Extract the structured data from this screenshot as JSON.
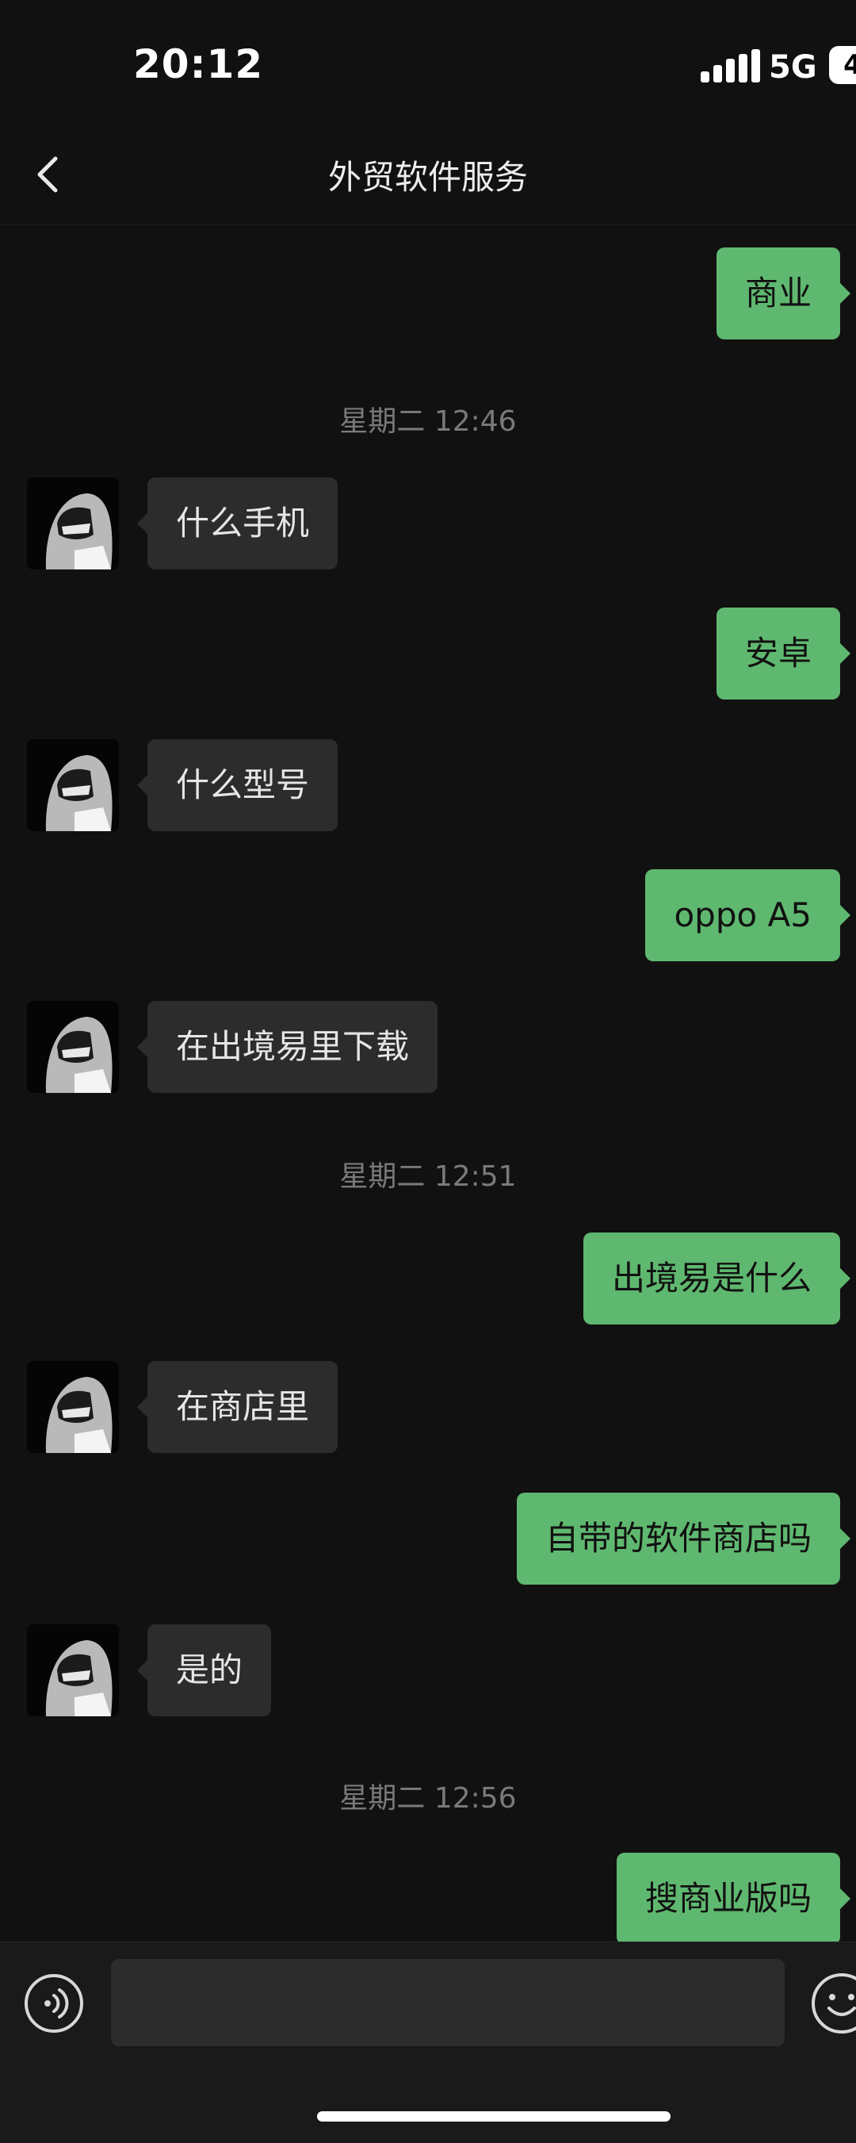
{
  "status_bar": {
    "time": "20:12",
    "network": "5G",
    "battery": "4"
  },
  "header": {
    "title": "外贸软件服务"
  },
  "messages": [
    {
      "type": "out",
      "text": "商业"
    },
    {
      "type": "time",
      "text": "星期二 12:46"
    },
    {
      "type": "in",
      "text": "什么手机"
    },
    {
      "type": "out",
      "text": "安卓"
    },
    {
      "type": "in",
      "text": "什么型号"
    },
    {
      "type": "out",
      "text": "oppo A5"
    },
    {
      "type": "in",
      "text": "在出境易里下载"
    },
    {
      "type": "time",
      "text": "星期二 12:51"
    },
    {
      "type": "out",
      "text": "出境易是什么"
    },
    {
      "type": "in",
      "text": "在商店里"
    },
    {
      "type": "out",
      "text": "自带的软件商店吗"
    },
    {
      "type": "in",
      "text": "是的"
    },
    {
      "type": "time",
      "text": "星期二 12:56"
    },
    {
      "type": "out",
      "text": "搜商业版吗"
    }
  ],
  "input": {
    "value": "",
    "placeholder": ""
  },
  "icons": {
    "back": "chevron-left-icon",
    "voice": "voice-icon",
    "emoji": "emoji-icon"
  },
  "colors": {
    "background": "#111111",
    "bubble_out": "#5fb86f",
    "bubble_in": "#2c2c2c"
  }
}
